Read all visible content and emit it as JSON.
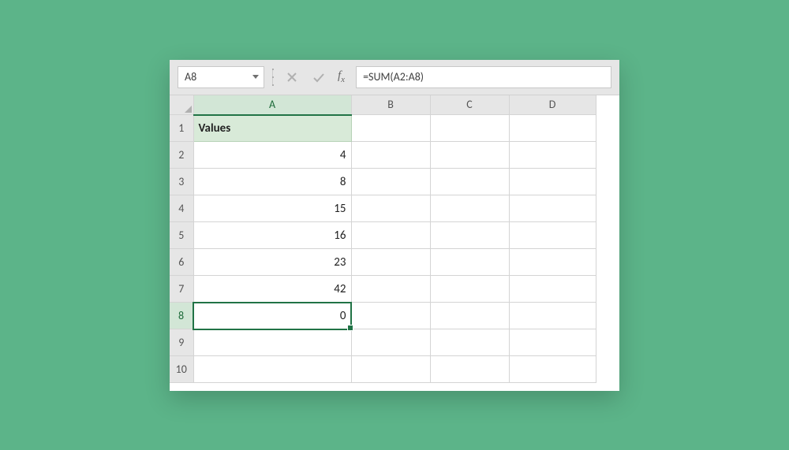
{
  "formula_bar": {
    "name_box_value": "A8",
    "formula_value": "=SUM(A2:A8)"
  },
  "columns": [
    "A",
    "B",
    "C",
    "D"
  ],
  "selected_column": "A",
  "selected_row": 8,
  "rows": [
    {
      "n": 1,
      "A": "Values",
      "isHeader": true
    },
    {
      "n": 2,
      "A": "4"
    },
    {
      "n": 3,
      "A": "8"
    },
    {
      "n": 4,
      "A": "15"
    },
    {
      "n": 5,
      "A": "16"
    },
    {
      "n": 6,
      "A": "23"
    },
    {
      "n": 7,
      "A": "42"
    },
    {
      "n": 8,
      "A": "0",
      "active": true
    },
    {
      "n": 9,
      "A": ""
    },
    {
      "n": 10,
      "A": ""
    }
  ],
  "chart_data": {
    "type": "table",
    "title": "Values",
    "categories": [
      "Row 2",
      "Row 3",
      "Row 4",
      "Row 5",
      "Row 6",
      "Row 7",
      "Row 8"
    ],
    "values": [
      4,
      8,
      15,
      16,
      23,
      42,
      0
    ],
    "formula": "=SUM(A2:A8)"
  }
}
